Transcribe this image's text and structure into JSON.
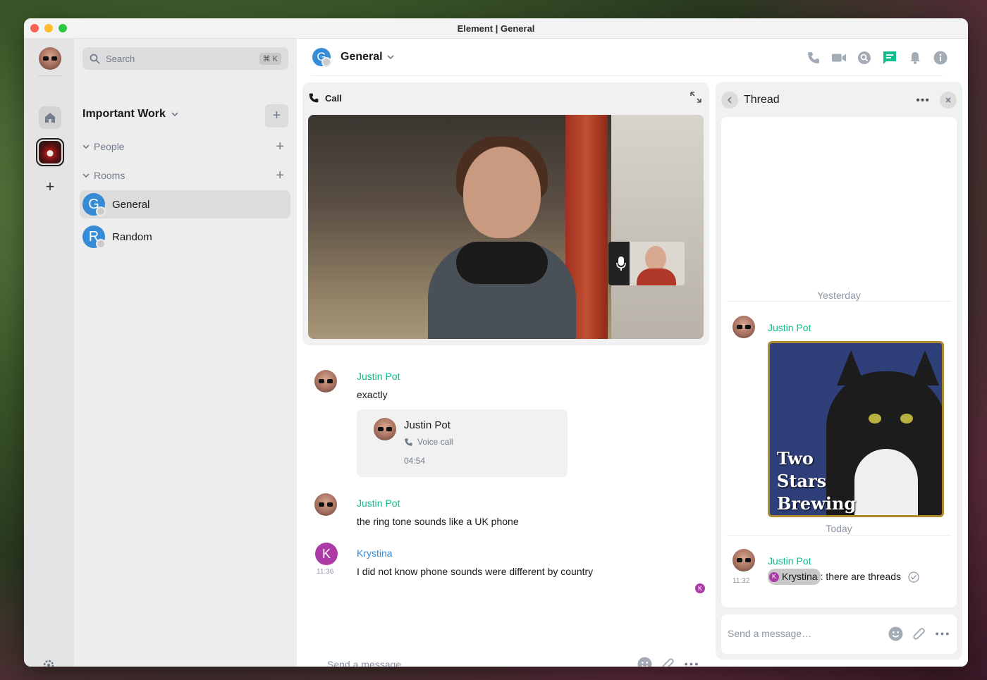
{
  "window": {
    "title": "Element | General"
  },
  "search": {
    "label": "Search",
    "shortcut": "⌘ K"
  },
  "space": {
    "name": "Important Work"
  },
  "sections": {
    "people": "People",
    "rooms": "Rooms"
  },
  "rooms": [
    {
      "initial": "G",
      "name": "General",
      "active": true
    },
    {
      "initial": "R",
      "name": "Random",
      "active": false
    }
  ],
  "header": {
    "initial": "G",
    "room_name": "General"
  },
  "call": {
    "title": "Call"
  },
  "timeline": [
    {
      "sender": "Justin Pot",
      "body": "exactly"
    },
    {
      "callcard": {
        "name": "Justin Pot",
        "kind": "Voice call",
        "duration": "04:54"
      }
    },
    {
      "sender": "Justin Pot",
      "body": "the ring tone sounds like a UK phone"
    },
    {
      "sender": "Krystina",
      "initial": "K",
      "time": "11:36",
      "body": "I did not know phone sounds were different by country"
    }
  ],
  "receipt": {
    "initial": "K"
  },
  "composer": {
    "placeholder": "Send a message…"
  },
  "thread": {
    "title": "Thread",
    "yesterday": "Yesterday",
    "today": "Today",
    "first_sender": "Justin Pot",
    "image_text": [
      "Two",
      "Stars",
      "Brewing"
    ],
    "reply": {
      "sender": "Justin Pot",
      "time": "11:32",
      "mention_initial": "K",
      "mention": "Krystina",
      "text": ": there are threads"
    },
    "composer_placeholder": "Send a message…"
  },
  "colors": {
    "accent": "#0dbd8b",
    "room_avatar": "#368bd6",
    "krystina": "#ac3ba8"
  }
}
